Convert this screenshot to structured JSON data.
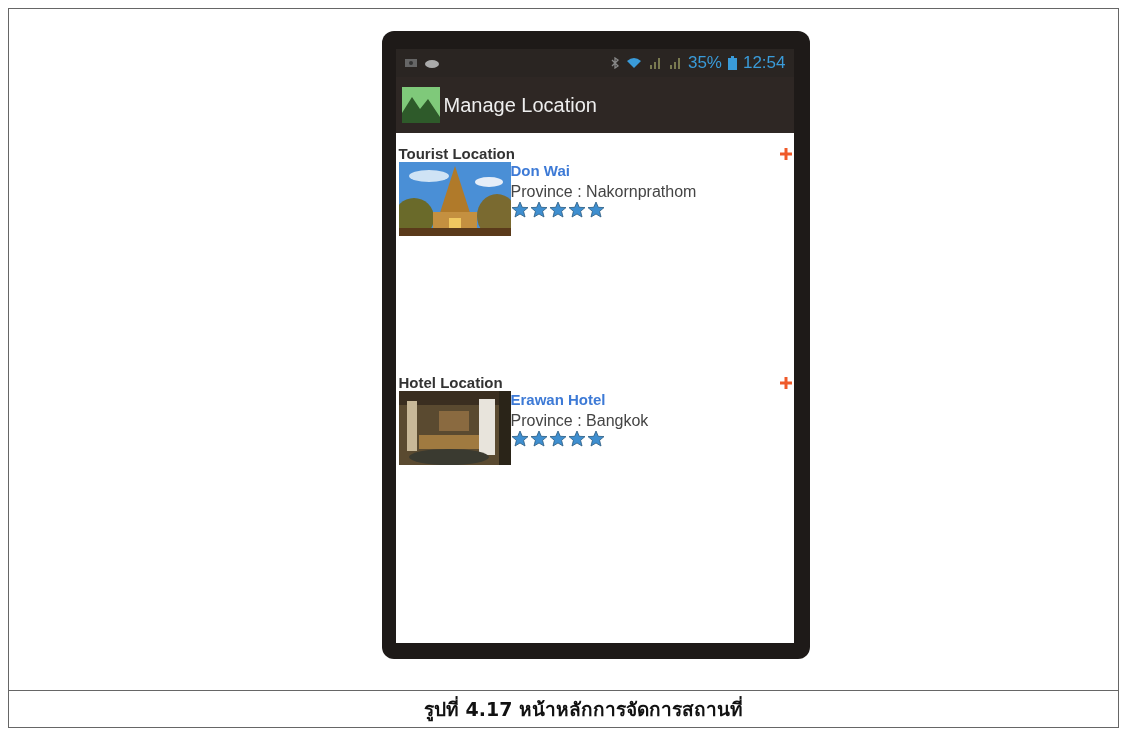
{
  "status_bar": {
    "battery": "35%",
    "time": "12:54"
  },
  "action_bar": {
    "title": "Manage Location"
  },
  "sections": [
    {
      "title": "Tourist Location",
      "items": [
        {
          "kind": "picture",
          "name": "Don Wai",
          "province": "Province : Nakornprathom",
          "stars": 5
        }
      ]
    },
    {
      "title": "Hotel Location",
      "items": [
        {
          "kind": "picture",
          "name": "Erawan Hotel",
          "province": "Province : Bangkok",
          "stars": 5
        }
      ]
    }
  ],
  "caption": "รูปที่ 4.17 หน้าหลักการจัดการสถานที่"
}
